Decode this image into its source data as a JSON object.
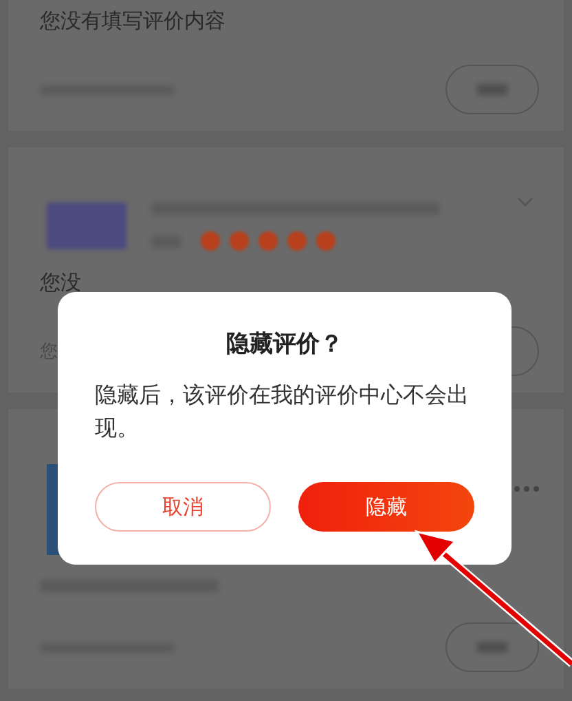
{
  "cards": [
    {
      "comment": {
        "title": "您没有填写评价内容"
      }
    },
    {
      "product": {
        "stars": 5
      },
      "comment": {
        "title": "您没",
        "subtitle": "您"
      }
    },
    {
      "product": {
        "more": true
      }
    }
  ],
  "dialog": {
    "title": "隐藏评价？",
    "message": "隐藏后，该评价在我的评价中心不会出现。",
    "buttons": [
      {
        "label": "取消",
        "kind": "secondary"
      },
      {
        "label": "隐藏",
        "kind": "primary"
      }
    ]
  },
  "annotation": {
    "kind": "arrow"
  }
}
